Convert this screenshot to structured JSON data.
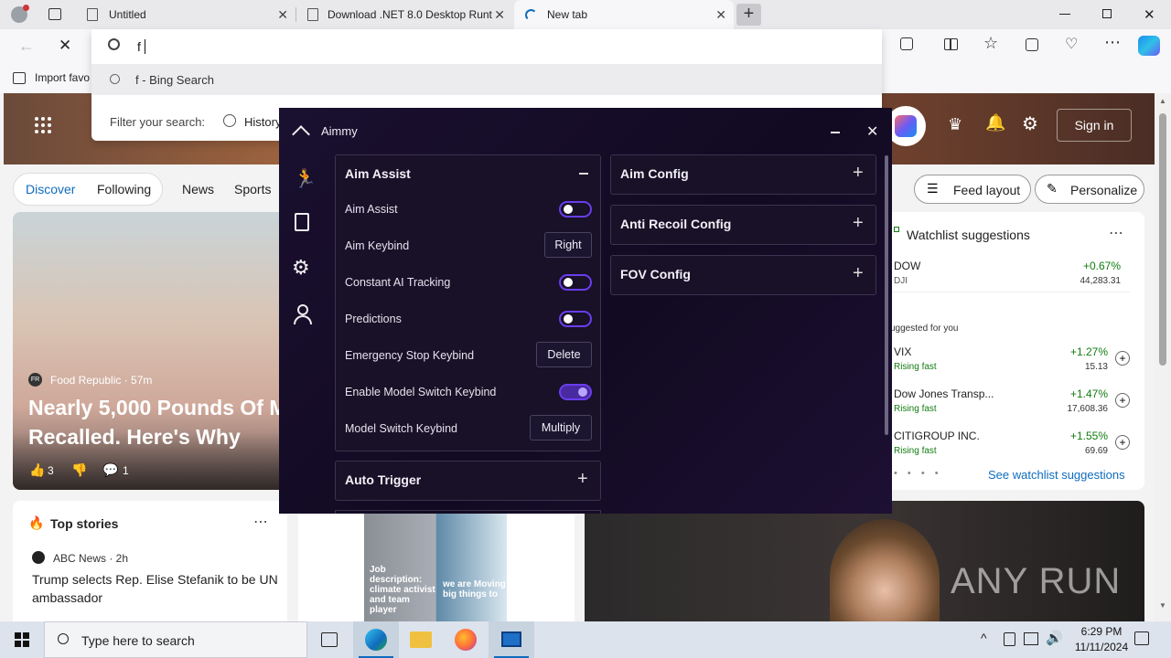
{
  "tabs": [
    {
      "title": "Untitled"
    },
    {
      "title": "Download .NET 8.0 Desktop Runt"
    },
    {
      "title": "New tab"
    }
  ],
  "address": {
    "value": "f",
    "suggestion": "f - Bing Search"
  },
  "favorites": {
    "import_label": "Import favo"
  },
  "filter": {
    "label": "Filter your search:",
    "history": "History"
  },
  "msn": {
    "sign_in": "Sign in",
    "nav": [
      "Discover",
      "Following",
      "News",
      "Sports"
    ],
    "feed_layout": "Feed layout",
    "personalize": "Personalize",
    "hero": {
      "source": "Food Republic · 57m",
      "source_badge": "FR",
      "headline": "Nearly 5,000 Pounds Of M Recalled. Here's Why",
      "likes": "3",
      "comments": "1"
    },
    "top_stories": {
      "title": "Top stories",
      "source": "ABC News · 2h",
      "headline": "Trump selects Rep. Elise Stefanik to be UN ambassador"
    },
    "ad": {
      "line1": "Job description: climate activist and team player",
      "line2": "we are Moving big things to"
    },
    "watchlist": {
      "title": "Watchlist suggestions",
      "top": {
        "name": "DOW",
        "ticker": "DJI",
        "change": "+0.67%",
        "value": "44,283.31"
      },
      "suggested_label": "uggested for you",
      "items": [
        {
          "name": "VIX",
          "note": "Rising fast",
          "change": "+1.27%",
          "value": "15.13"
        },
        {
          "name": "Dow Jones Transp...",
          "note": "Rising fast",
          "change": "+1.47%",
          "value": "17,608.36"
        },
        {
          "name": "CITIGROUP INC.",
          "note": "Rising fast",
          "change": "+1.55%",
          "value": "69.69"
        }
      ],
      "see_more": "See watchlist suggestions"
    },
    "watermark": "ANY RUN"
  },
  "aimmy": {
    "title": "Aimmy",
    "aim_assist": {
      "title": "Aim Assist",
      "rows": [
        {
          "label": "Aim Assist",
          "type": "toggle",
          "on": false
        },
        {
          "label": "Aim Keybind",
          "type": "key",
          "value": "Right"
        },
        {
          "label": "Constant AI Tracking",
          "type": "toggle",
          "on": false
        },
        {
          "label": "Predictions",
          "type": "toggle",
          "on": false
        },
        {
          "label": "Emergency Stop Keybind",
          "type": "key",
          "value": "Delete"
        },
        {
          "label": "Enable Model Switch Keybind",
          "type": "toggle",
          "on": true
        },
        {
          "label": "Model Switch Keybind",
          "type": "key",
          "value": "Multiply"
        }
      ]
    },
    "auto_trigger": "Auto Trigger",
    "right_panels": [
      "Aim Config",
      "Anti Recoil Config",
      "FOV Config"
    ]
  },
  "taskbar": {
    "search_placeholder": "Type here to search",
    "time": "6:29 PM",
    "date": "11/11/2024"
  },
  "colors": {
    "accent": "#6a3df0",
    "aimmy_bg": "#150c26",
    "msn_blue": "#0f6cbd",
    "green": "#107c10"
  }
}
